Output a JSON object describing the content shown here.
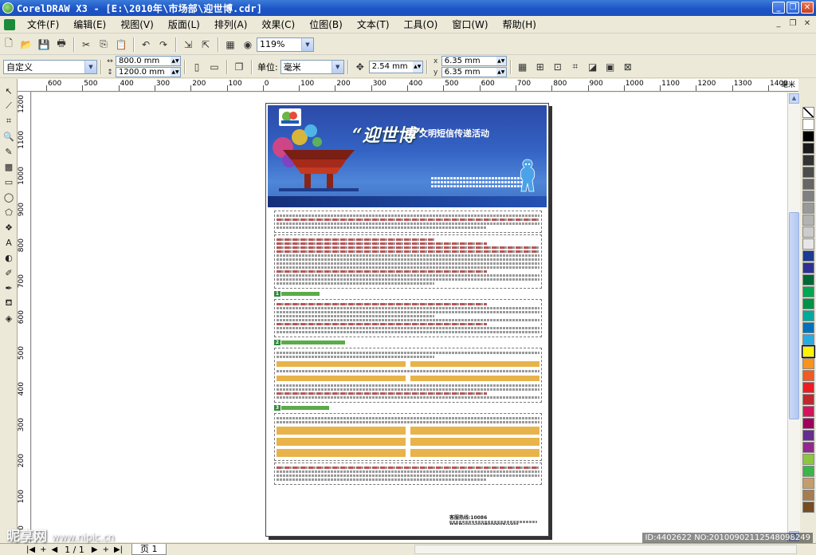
{
  "window": {
    "title": "CorelDRAW X3 - [E:\\2010年\\市场部\\迎世博.cdr]",
    "controls": [
      "_",
      "❐",
      "✕"
    ]
  },
  "menu": {
    "items": [
      "文件(F)",
      "编辑(E)",
      "视图(V)",
      "版面(L)",
      "排列(A)",
      "效果(C)",
      "位图(B)",
      "文本(T)",
      "工具(O)",
      "窗口(W)",
      "帮助(H)"
    ],
    "doc_controls": [
      "_",
      "❐",
      "✕"
    ]
  },
  "toolbar_standard": {
    "zoom_value": "119%"
  },
  "property_bar": {
    "paper_preset": "自定义",
    "width": "800.0 mm",
    "height": "1200.0 mm",
    "units_label": "单位:",
    "units_value": "毫米",
    "nudge": "2.54 mm",
    "dup_x": "6.35 mm",
    "dup_y": "6.35 mm"
  },
  "ruler": {
    "h_ticks": [
      "600",
      "500",
      "400",
      "300",
      "200",
      "100",
      "0",
      "100",
      "200",
      "300",
      "400",
      "500",
      "600",
      "700",
      "800",
      "900",
      "1000",
      "1100",
      "1200",
      "1300",
      "1400"
    ],
    "unit": "毫米",
    "v_ticks": [
      "1200",
      "1100",
      "1000",
      "900",
      "800",
      "700",
      "600",
      "500",
      "400",
      "300",
      "200",
      "100",
      "0"
    ]
  },
  "document": {
    "banner_title": "“迎世博”",
    "banner_subtitle": "文明短信传递活动",
    "section_numbers": [
      "1",
      "2",
      "3"
    ],
    "hotline": "客服热线:10086 www.hn.chinamobile.com"
  },
  "palette": {
    "colors": [
      "#ffffff",
      "#000000",
      "#1a1a1a",
      "#333333",
      "#4d4d4d",
      "#666666",
      "#808080",
      "#999999",
      "#b3b3b3",
      "#cccccc",
      "#e6e6e6",
      "#1f3a93",
      "#2e3192",
      "#006837",
      "#00a651",
      "#009245",
      "#00a99d",
      "#0071bc",
      "#29abe2",
      "#fff200",
      "#f7931e",
      "#f15a24",
      "#ed1c24",
      "#c1272d",
      "#d4145a",
      "#9e005d",
      "#662d91",
      "#93278f",
      "#8cc63f",
      "#39b54a",
      "#c69c6d",
      "#a67c52",
      "#754c24"
    ],
    "selected_color": "#fff200"
  },
  "status": {
    "page_counter": "1 / 1",
    "page_tab": "页 1"
  },
  "watermark": {
    "site": "昵享网",
    "url": "www.nipic.cn",
    "id_text": "ID:4402622 NO:20100902112548098249"
  }
}
